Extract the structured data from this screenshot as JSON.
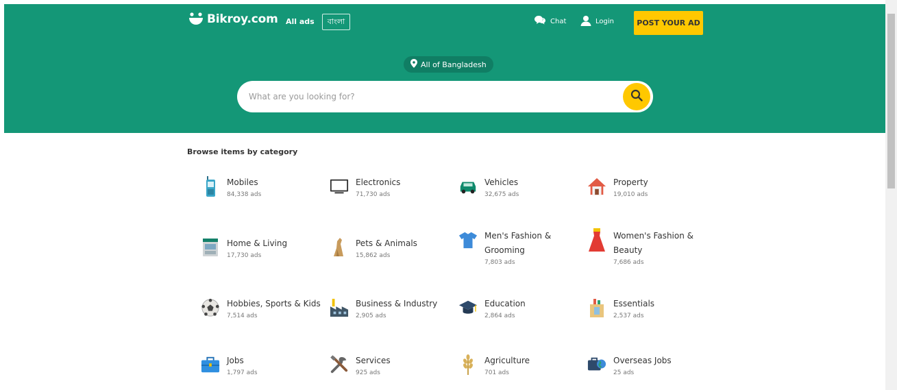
{
  "header": {
    "logo_text": "Bikroy.com",
    "all_ads": "All ads",
    "language": "বাংলা",
    "chat": "Chat",
    "login": "Login",
    "post_ad": "POST YOUR AD",
    "location": "All of Bangladesh",
    "search_placeholder": "What are you looking for?"
  },
  "colors": {
    "primary": "#149777",
    "accent": "#ffc800",
    "location_pill": "#107e64"
  },
  "browse_title": "Browse items by category",
  "categories": [
    {
      "name": "Mobiles",
      "count": "84,338 ads",
      "icon": "mobile-phone-icon"
    },
    {
      "name": "Electronics",
      "count": "71,730 ads",
      "icon": "monitor-icon"
    },
    {
      "name": "Vehicles",
      "count": "32,675 ads",
      "icon": "car-icon"
    },
    {
      "name": "Property",
      "count": "19,010 ads",
      "icon": "house-icon"
    },
    {
      "name": "Home & Living",
      "count": "17,730 ads",
      "icon": "furniture-icon"
    },
    {
      "name": "Pets & Animals",
      "count": "15,862 ads",
      "icon": "dog-icon"
    },
    {
      "name": "Men's Fashion & Grooming",
      "count": "7,803 ads",
      "icon": "tshirt-icon"
    },
    {
      "name": "Women's Fashion & Beauty",
      "count": "7,686 ads",
      "icon": "dress-icon"
    },
    {
      "name": "Hobbies, Sports & Kids",
      "count": "7,514 ads",
      "icon": "football-icon"
    },
    {
      "name": "Business & Industry",
      "count": "2,905 ads",
      "icon": "factory-icon"
    },
    {
      "name": "Education",
      "count": "2,864 ads",
      "icon": "graduation-cap-icon"
    },
    {
      "name": "Essentials",
      "count": "2,537 ads",
      "icon": "grocery-bag-icon"
    },
    {
      "name": "Jobs",
      "count": "1,797 ads",
      "icon": "briefcase-icon"
    },
    {
      "name": "Services",
      "count": "925 ads",
      "icon": "tools-icon"
    },
    {
      "name": "Agriculture",
      "count": "701 ads",
      "icon": "wheat-icon"
    },
    {
      "name": "Overseas Jobs",
      "count": "25 ads",
      "icon": "globe-briefcase-icon"
    }
  ]
}
